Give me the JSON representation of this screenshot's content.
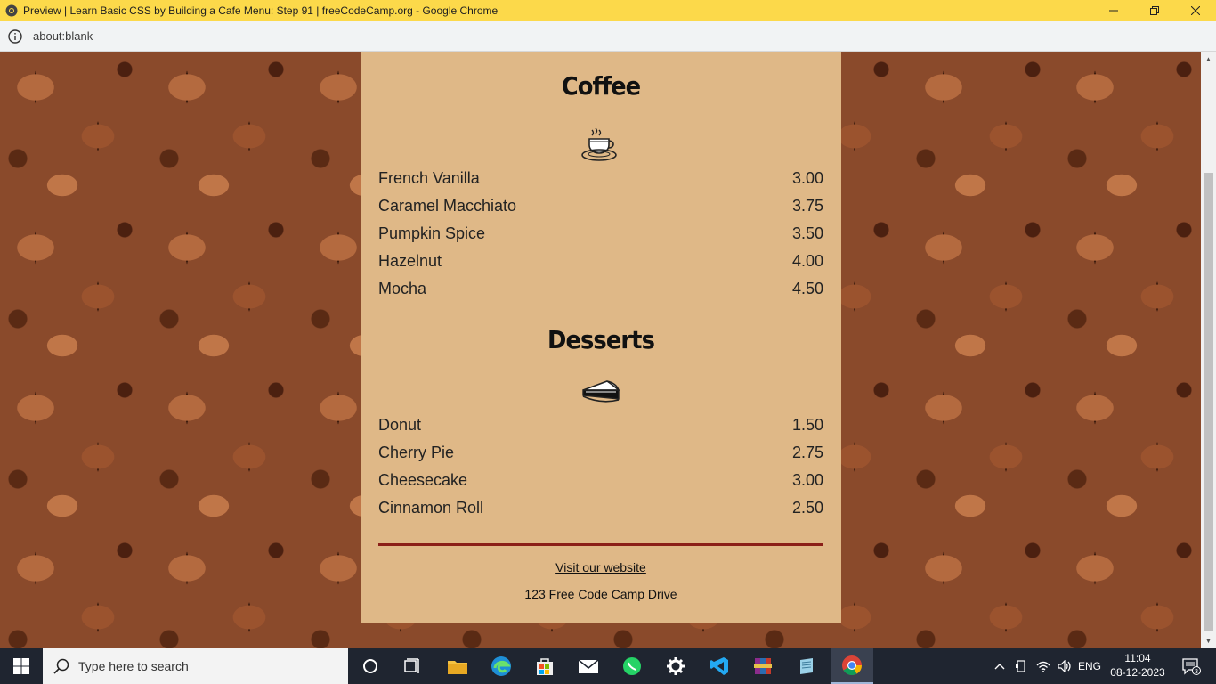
{
  "browser": {
    "window_title": "Preview | Learn Basic CSS by Building a Cafe Menu: Step 91 | freeCodeCamp.org - Google Chrome",
    "address": "about:blank"
  },
  "menu": {
    "sections": [
      {
        "title": "Coffee",
        "icon": "coffee-cup-icon",
        "items": [
          {
            "name": "French Vanilla",
            "price": "3.00"
          },
          {
            "name": "Caramel Macchiato",
            "price": "3.75"
          },
          {
            "name": "Pumpkin Spice",
            "price": "3.50"
          },
          {
            "name": "Hazelnut",
            "price": "4.00"
          },
          {
            "name": "Mocha",
            "price": "4.50"
          }
        ]
      },
      {
        "title": "Desserts",
        "icon": "pie-slice-icon",
        "items": [
          {
            "name": "Donut",
            "price": "1.50"
          },
          {
            "name": "Cherry Pie",
            "price": "2.75"
          },
          {
            "name": "Cheesecake",
            "price": "3.00"
          },
          {
            "name": "Cinnamon Roll",
            "price": "2.50"
          }
        ]
      }
    ],
    "footer": {
      "link_text": "Visit our website",
      "address": "123 Free Code Camp Drive"
    }
  },
  "taskbar": {
    "search_placeholder": "Type here to search",
    "language": "ENG",
    "time": "11:04",
    "date": "08-12-2023",
    "notification_count": "3"
  },
  "colors": {
    "menu_background": "#dfb887",
    "divider": "#8b1f18",
    "titlebar": "#fcd94a"
  }
}
